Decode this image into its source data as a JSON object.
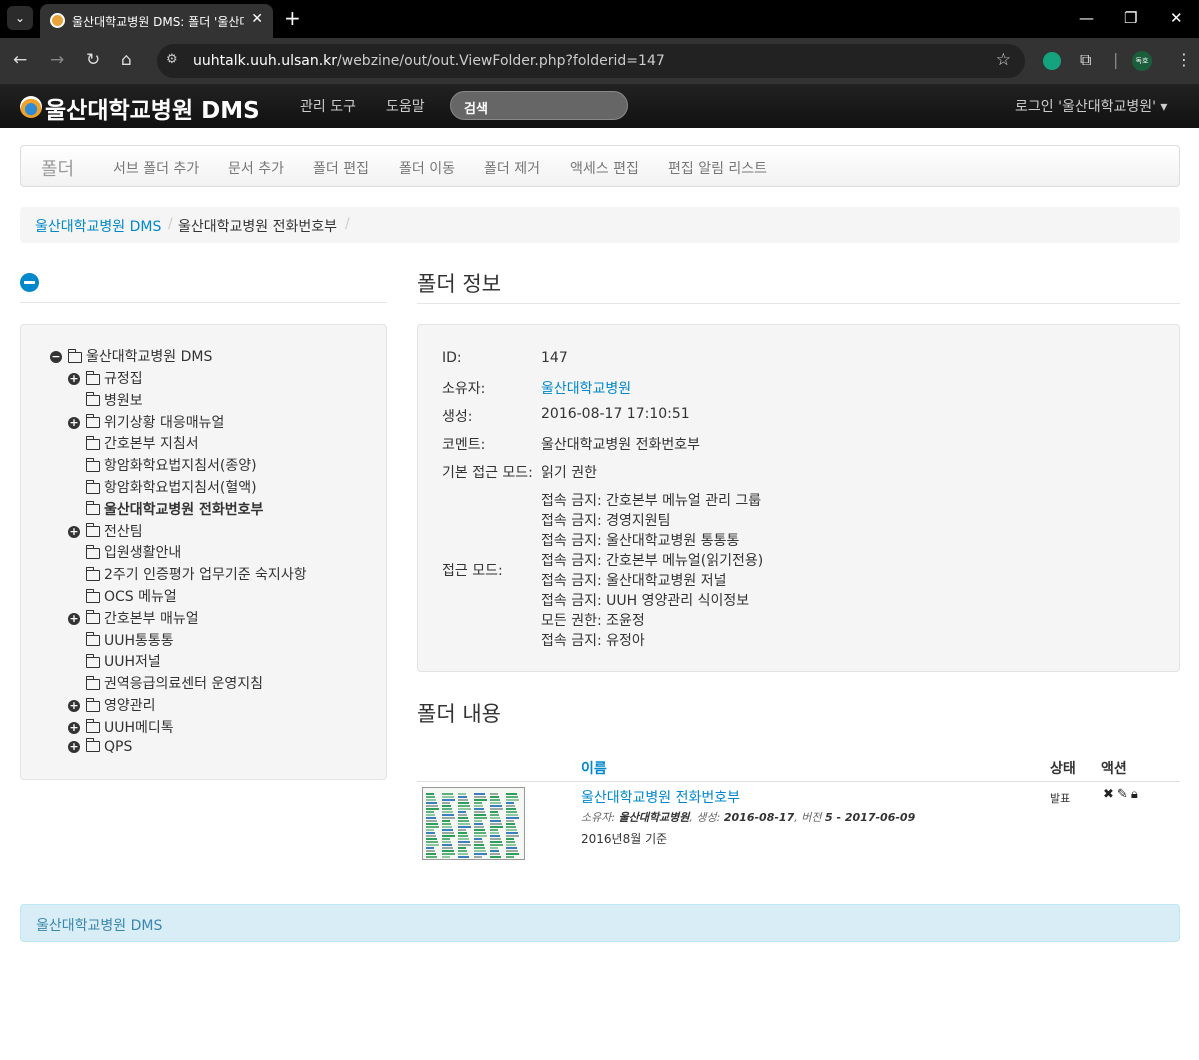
{
  "browser": {
    "tab_title": "울산대학교병원 DMS: 폴더 '울산대학교병원 전화번호부'",
    "tab_close": "✕",
    "new_tab": "+",
    "url_host": "uuhtalk.uuh.ulsan.kr",
    "url_path": "/webzine/out/out.ViewFolder.php?folderid=147",
    "profile_label": "독호"
  },
  "navbar": {
    "brand": "울산대학교병원 DMS",
    "links": [
      "관리 도구",
      "도움말"
    ],
    "search_placeholder": "검색",
    "user": "로그인 '울산대학교병원'"
  },
  "actionbar": {
    "title": "폴더",
    "items": [
      "서브 폴더 추가",
      "문서 추가",
      "폴더 편집",
      "폴더 이동",
      "폴더 제거",
      "액세스 편집",
      "편집 알림 리스트"
    ]
  },
  "breadcrumb": {
    "root": "울산대학교병원 DMS",
    "separator": "/",
    "current": "울산대학교병원 전화번호부",
    "trailing_separator": "/"
  },
  "tree": {
    "root": "울산대학교병원 DMS",
    "items": [
      {
        "label": "규정집",
        "expandable": true
      },
      {
        "label": "병원보",
        "expandable": false
      },
      {
        "label": "위기상황 대응매뉴얼",
        "expandable": true
      },
      {
        "label": "간호본부 지침서",
        "expandable": false
      },
      {
        "label": "항암화학요법지침서(종양)",
        "expandable": false
      },
      {
        "label": "항암화학요법지침서(혈액)",
        "expandable": false
      },
      {
        "label": "울산대학교병원 전화번호부",
        "expandable": false,
        "active": true
      },
      {
        "label": "전산팀",
        "expandable": true
      },
      {
        "label": "입원생활안내",
        "expandable": false
      },
      {
        "label": "2주기 인증평가 업무기준 숙지사항",
        "expandable": false
      },
      {
        "label": "OCS 메뉴얼",
        "expandable": false
      },
      {
        "label": "간호본부 매뉴얼",
        "expandable": true
      },
      {
        "label": "UUH통통통",
        "expandable": false
      },
      {
        "label": "UUH저널",
        "expandable": false
      },
      {
        "label": "권역응급의료센터 운영지침",
        "expandable": false
      },
      {
        "label": "영양관리",
        "expandable": true
      },
      {
        "label": "UUH메디톡",
        "expandable": true
      },
      {
        "label": "QPS",
        "expandable": true
      }
    ]
  },
  "folder_info": {
    "heading": "폴더 정보",
    "id_label": "ID:",
    "id": "147",
    "owner_label": "소유자:",
    "owner": "울산대학교병원",
    "created_label": "생성:",
    "created": "2016-08-17 17:10:51",
    "comment_label": "코멘트:",
    "comment": "울산대학교병원 전화번호부",
    "default_access_label": "기본 접근 모드:",
    "default_access": "읽기 권한",
    "access_label": "접근 모드:",
    "access_list": [
      "접속 금지: 간호본부 메뉴얼 관리 그룹",
      "접속 금지: 경영지원팀",
      "접속 금지: 울산대학교병원 통통통",
      "접속 금지: 간호본부 메뉴얼(읽기전용)",
      "접속 금지: 울산대학교병원 저널",
      "접속 금지: UUH 영양관리 식이정보",
      "모든 권한: 조윤정",
      "접속 금지: 유정아"
    ]
  },
  "folder_content": {
    "heading": "폴더 내용",
    "col_name": "이름",
    "col_status": "상태",
    "col_action": "액션",
    "doc": {
      "title": "울산대학교병원 전화번호부",
      "owner_label": "소유자:",
      "owner": "울산대학교병원",
      "created_label": "생성:",
      "created": "2016-08-17",
      "version_label": "버전",
      "version": "5 - 2017-06-09",
      "comment": "2016년8월 기준",
      "status": "발표",
      "actions": [
        "delete-icon",
        "edit-icon",
        "lock-icon"
      ]
    }
  },
  "footer": {
    "text": "울산대학교병원 DMS"
  }
}
